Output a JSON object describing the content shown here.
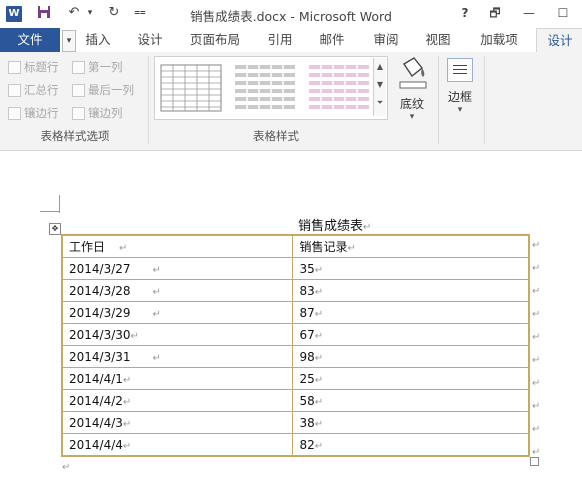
{
  "window": {
    "title": "销售成绩表.docx - Microsoft Word",
    "help": "?",
    "restore": "🗗",
    "minimize": "—",
    "restore2": "☐"
  },
  "qat": {
    "logo": "W",
    "save": "💾",
    "undo": "↶",
    "undo_dropdown": "▾",
    "redo": "↻",
    "customize": "⩵"
  },
  "tabs": {
    "file": "文件",
    "insert": "插入",
    "design": "设计",
    "page_layout": "页面布局",
    "references": "引用",
    "mailings": "邮件",
    "review": "审阅",
    "view": "视图",
    "addins": "加载项",
    "table_design": "设计"
  },
  "ribbon": {
    "style_options": {
      "header_row": "标题行",
      "first_column": "第一列",
      "total_row": "汇总行",
      "last_column": "最后一列",
      "banded_rows": "镶边行",
      "banded_columns": "镶边列",
      "group_label": "表格样式选项"
    },
    "table_styles": {
      "group_label": "表格样式"
    },
    "shading": {
      "label": "底纹",
      "dropdown": "▾"
    },
    "borders": {
      "label": "边框",
      "dropdown": "▾"
    }
  },
  "document": {
    "table_title": "销售成绩表",
    "paragraph_mark": "↵",
    "header": [
      "工作日",
      "销售记录"
    ],
    "rows": [
      [
        "2014/3/27",
        "35"
      ],
      [
        "2014/3/28",
        "83"
      ],
      [
        "2014/3/29",
        "87"
      ],
      [
        "2014/3/30",
        "67"
      ],
      [
        "2014/3/31",
        "98"
      ],
      [
        "2014/4/1",
        "25"
      ],
      [
        "2014/4/2",
        "58"
      ],
      [
        "2014/4/3",
        "38"
      ],
      [
        "2014/4/4",
        "82"
      ]
    ]
  },
  "colors": {
    "accent": "#2b579a",
    "table_border": "#c8a964",
    "ribbon_bg": "#f3f3f3"
  }
}
